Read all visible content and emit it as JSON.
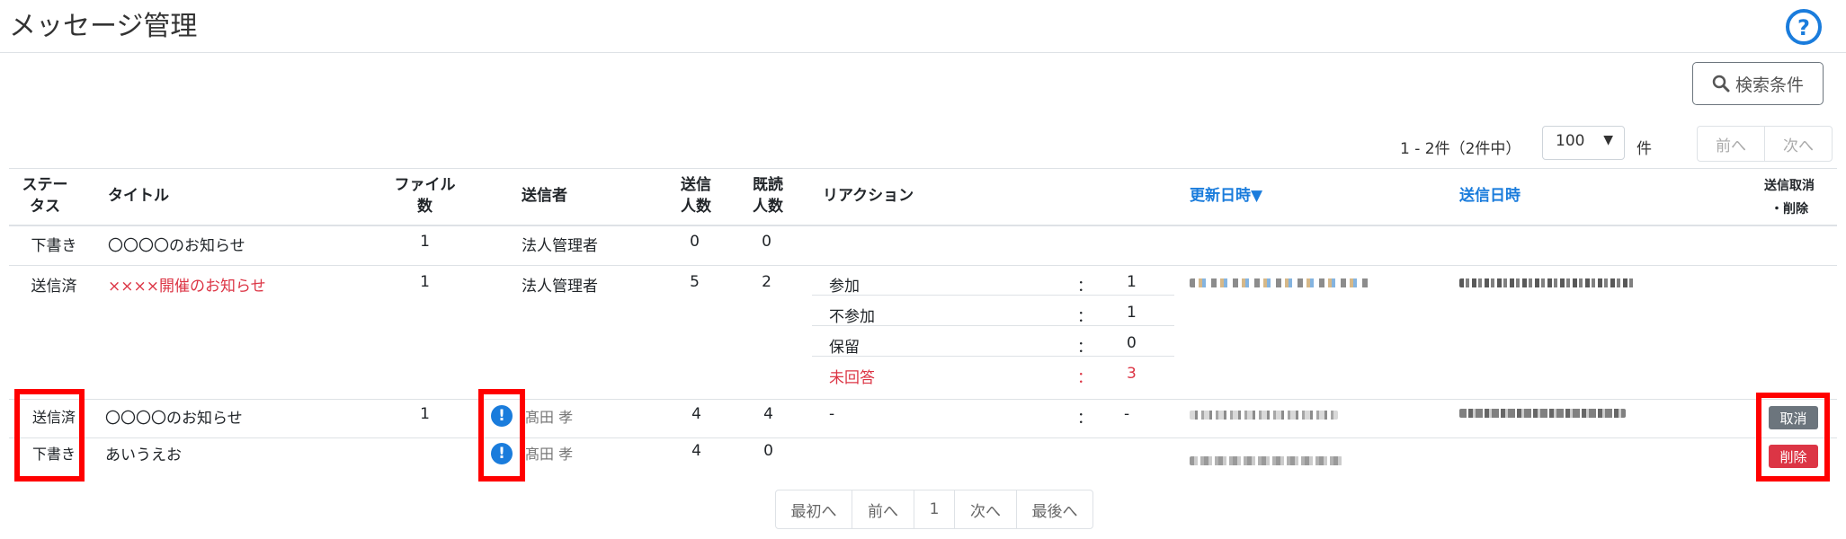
{
  "header": {
    "title": "メッセージ管理",
    "help_icon": "question-circle-icon"
  },
  "toolbar": {
    "search_button": "検索条件",
    "search_icon": "magnifier-icon"
  },
  "pagination_top": {
    "count": "1 - 2件（2件中）",
    "page_size": "100",
    "unit": "件",
    "prev": "前へ",
    "next": "次へ"
  },
  "table": {
    "headers": {
      "status": [
        "ステー",
        "タス"
      ],
      "title": "タイトル",
      "files": [
        "ファイル",
        "数"
      ],
      "sender": "送信者",
      "sent_count": [
        "送信",
        "人数"
      ],
      "read_count": [
        "既読",
        "人数"
      ],
      "reaction": "リアクション",
      "updated": "更新日時▼",
      "sent_at": "送信日時",
      "cancel_delete": [
        "送信取消",
        "・削除"
      ]
    },
    "rows": [
      {
        "status": "下書き",
        "title": "〇〇〇〇のお知らせ",
        "files": "1",
        "sender": "法人管理者",
        "sent": "0",
        "read": "0"
      },
      {
        "status": "送信済",
        "title": "××××開催のお知らせ",
        "files": "1",
        "sender": "法人管理者",
        "sent": "5",
        "read": "2",
        "reactions": [
          {
            "label": "参加",
            "sep": "：",
            "value": "1"
          },
          {
            "label": "不参加",
            "sep": "：",
            "value": "1"
          },
          {
            "label": "保留",
            "sep": "：",
            "value": "0"
          },
          {
            "label": "未回答",
            "sep": "：",
            "value": "3"
          }
        ]
      },
      {
        "status": "送信済",
        "title": "〇〇〇〇のお知らせ",
        "files": "1",
        "sender": "髙田 孝",
        "sent": "4",
        "read": "4",
        "reaction": {
          "label": "-",
          "sep": "：",
          "value": "-"
        },
        "action": "取消"
      },
      {
        "status": "下書き",
        "title": "あいうえお",
        "files": "",
        "sender": "髙田 孝",
        "sent": "4",
        "read": "0",
        "action": "削除"
      }
    ]
  },
  "pagination_bottom": {
    "first": "最初へ",
    "prev": "前へ",
    "page": "1",
    "next": "次へ",
    "last": "最後へ"
  },
  "colors": {
    "link": "#1a7cdc",
    "danger": "#dc3545",
    "secondary": "#6c757d",
    "highlight": "#ff0000"
  }
}
